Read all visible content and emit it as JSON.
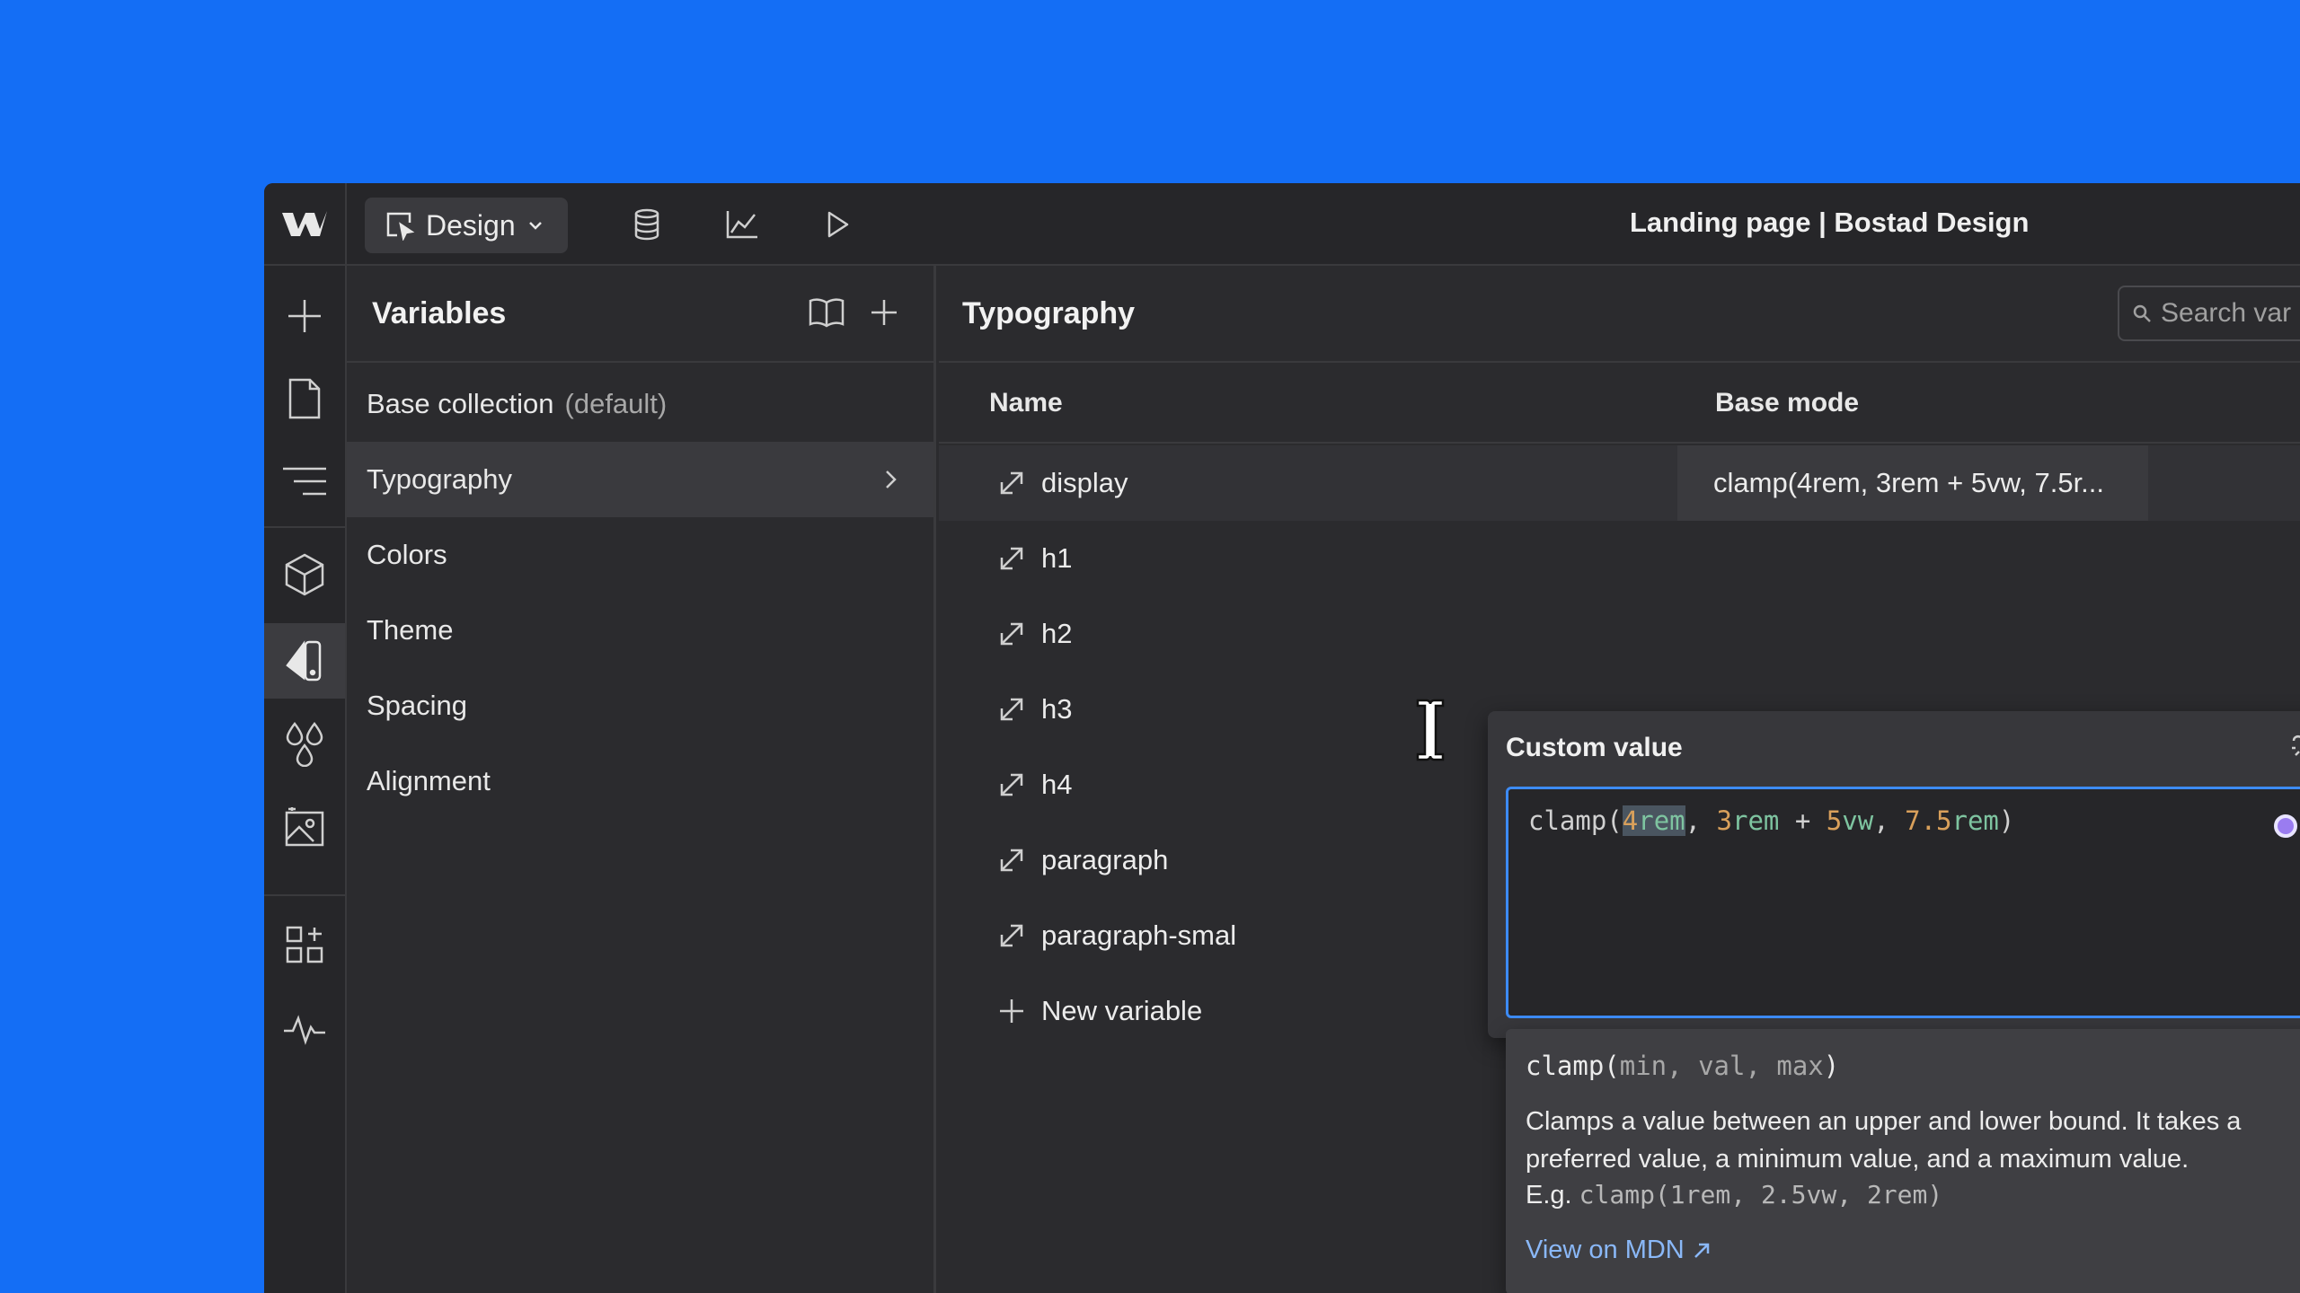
{
  "topbar": {
    "mode_label": "Design",
    "page_title": "Landing page | Bostad Design"
  },
  "variables_panel": {
    "title": "Variables",
    "collections": [
      {
        "label": "Base collection",
        "suffix": "(default)"
      },
      {
        "label": "Typography"
      },
      {
        "label": "Colors"
      },
      {
        "label": "Theme"
      },
      {
        "label": "Spacing"
      },
      {
        "label": "Alignment"
      }
    ]
  },
  "main": {
    "title": "Typography",
    "search_placeholder": "Search var",
    "columns": {
      "name": "Name",
      "mode": "Base mode"
    },
    "rows": [
      {
        "name": "display",
        "value": "clamp(4rem, 3rem + 5vw, 7.5r..."
      },
      {
        "name": "h1"
      },
      {
        "name": "h2"
      },
      {
        "name": "h3"
      },
      {
        "name": "h4"
      },
      {
        "name": "paragraph"
      },
      {
        "name": "paragraph-smal"
      }
    ],
    "new_variable_label": "New variable"
  },
  "popover": {
    "title": "Custom value",
    "code": {
      "fn": "clamp(",
      "a_num": "4",
      "a_unit": "rem",
      "sep1": ", ",
      "b_num": "3",
      "b_unit": "rem",
      "op": " + ",
      "c_num": "5",
      "c_unit": "vw",
      "sep2": ", ",
      "d_num": "7.5",
      "d_unit": "rem",
      "close": ")"
    }
  },
  "docs": {
    "sig_fn": "clamp(",
    "sig_params": "min, val, max",
    "sig_close": ")",
    "description": "Clamps a value between an upper and lower bound. It takes a preferred value, a minimum value, and a maximum value.",
    "example_prefix": "E.g.",
    "example_code": "clamp(1rem, 2.5vw, 2rem)",
    "link_label": "View on MDN"
  },
  "colors": {
    "background": "#146ef5",
    "accent": "#3d8bf5",
    "number_token": "#d9a05b",
    "unit_token": "#7ec4a0"
  },
  "icons": {
    "logo": "webflow-logo-icon",
    "mode": "cursor-select-icon",
    "cms": "database-icon",
    "analyze": "chart-line-icon",
    "preview": "play-icon",
    "rail": [
      "plus-icon",
      "page-icon",
      "navigator-icon",
      "components-icon",
      "variables-icon",
      "styles-icon",
      "assets-icon",
      "apps-icon",
      "audit-icon"
    ]
  }
}
